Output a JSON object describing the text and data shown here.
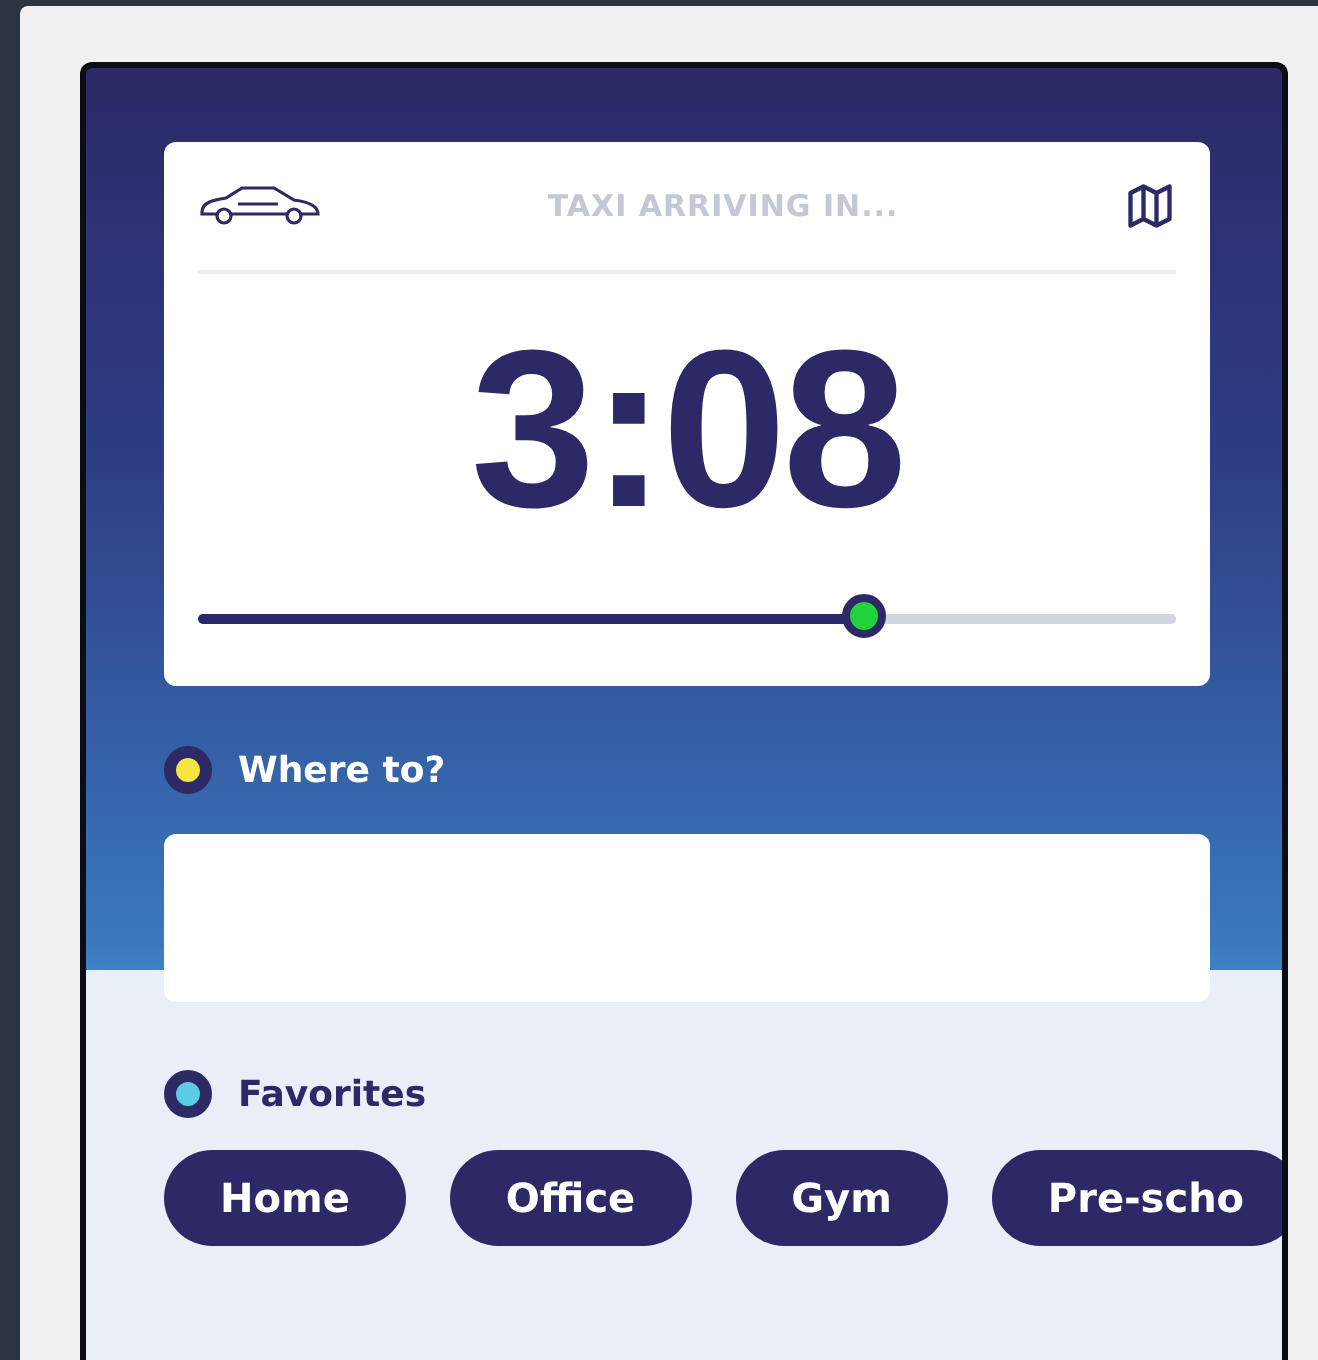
{
  "card": {
    "status": "TAXI ARRIVING IN...",
    "countdown": "3:08",
    "progress": {
      "level": 0.68
    }
  },
  "sections": [
    {
      "kind": "input",
      "label": "Where to?",
      "color": "#f5e642"
    },
    {
      "kind": "chips",
      "label": "Favorites",
      "color": "#5ccbe6",
      "chips": [
        "Home",
        "Office",
        "Gym",
        "Pre-scho"
      ]
    }
  ]
}
